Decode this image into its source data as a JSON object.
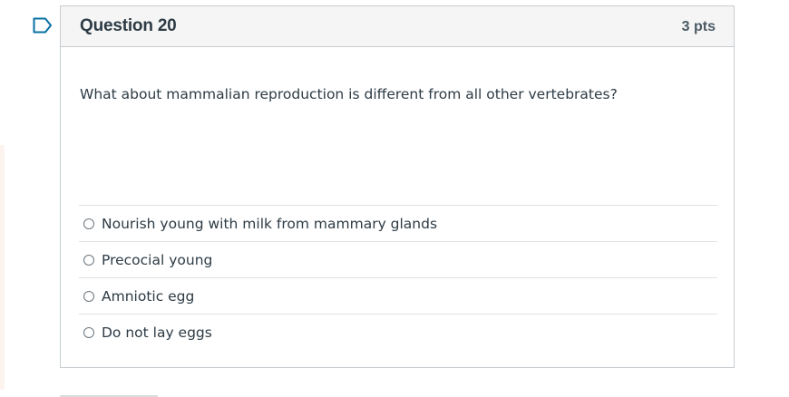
{
  "question": {
    "title": "Question 20",
    "points": "3 pts",
    "text": "What about mammalian reproduction is different from all other vertebrates?",
    "answers": [
      {
        "label": "Nourish young with milk from mammary glands",
        "selected": false
      },
      {
        "label": "Precocial young",
        "selected": false
      },
      {
        "label": "Amniotic egg",
        "selected": false
      },
      {
        "label": "Do not lay eggs",
        "selected": false
      }
    ]
  },
  "icons": {
    "flag": "bookmark-flag-icon"
  },
  "colors": {
    "flag": "#0770a3",
    "header_bg": "#f5f5f5",
    "border": "#c7cdd1",
    "text": "#2d3b45"
  }
}
